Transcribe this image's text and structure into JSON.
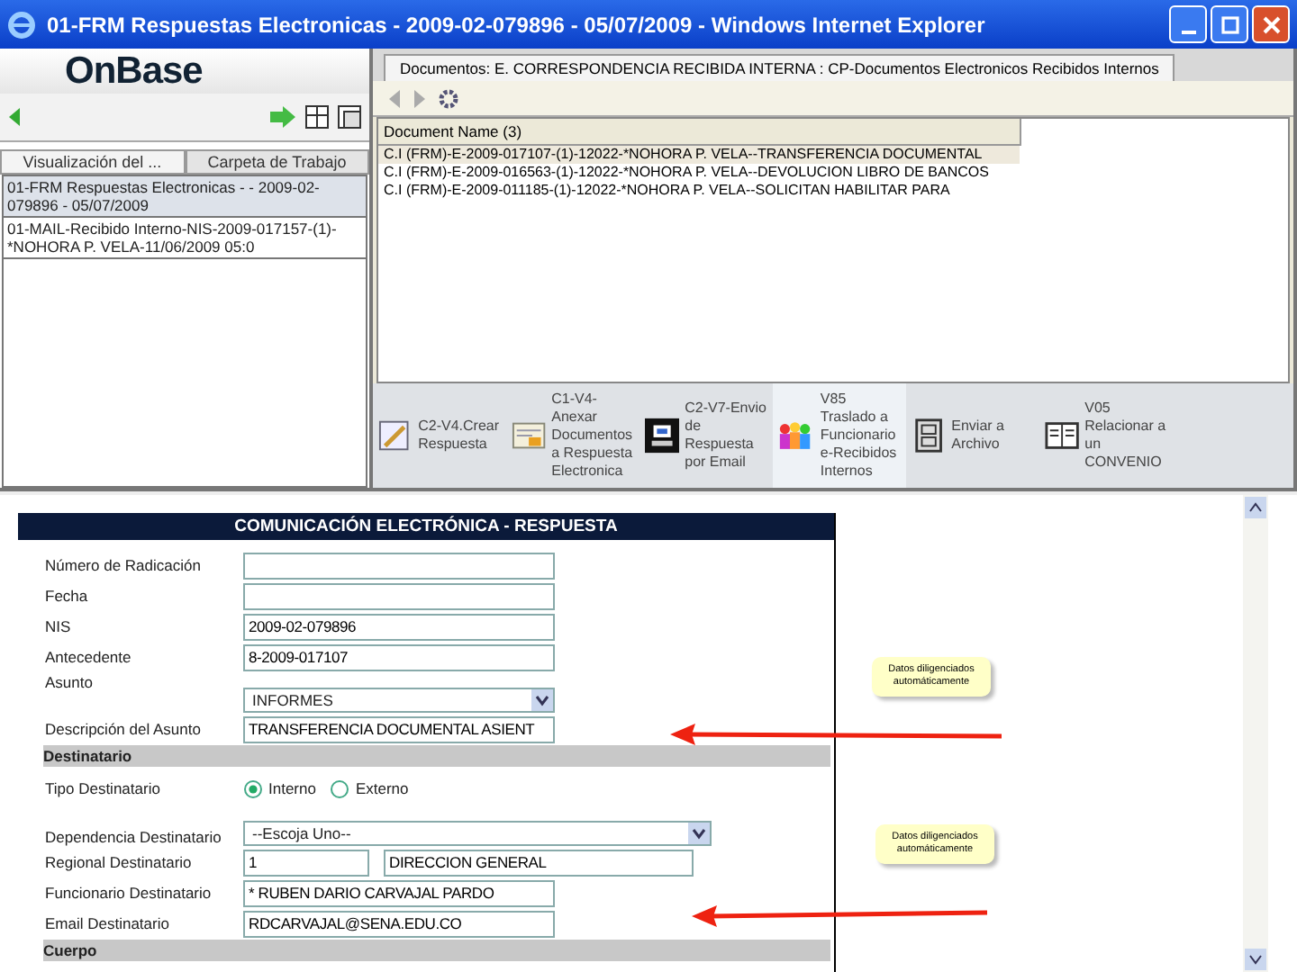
{
  "window": {
    "title": "01-FRM Respuestas Electronicas - 2009-02-079896 - 05/07/2009 - Windows Internet Explorer"
  },
  "logo": "OnBase",
  "left_tabs": [
    {
      "label": "Visualización del ...",
      "selected": true
    },
    {
      "label": "Carpeta de Trabajo",
      "selected": false
    }
  ],
  "left_items": [
    {
      "text": "01-FRM Respuestas Electronicas - - 2009-02-079896 - 05/07/2009",
      "selected": true
    },
    {
      "text": "01-MAIL-Recibido Interno-NIS-2009-017157-(1)-*NOHORA P. VELA-11/06/2009 05:0",
      "selected": false
    }
  ],
  "documents": {
    "tab": "Documentos: E. CORRESPONDENCIA RECIBIDA INTERNA : CP-Documentos Electronicos Recibidos Internos",
    "column": "Document Name (3)",
    "rows": [
      {
        "text": "C.I (FRM)-E-2009-017107-(1)-12022-*NOHORA P. VELA--TRANSFERENCIA DOCUMENTAL",
        "selected": true
      },
      {
        "text": "C.I (FRM)-E-2009-016563-(1)-12022-*NOHORA P. VELA--DEVOLUCION LIBRO DE BANCOS",
        "selected": false
      },
      {
        "text": "C.I (FRM)-E-2009-011185-(1)-12022-*NOHORA P. VELA--SOLICITAN HABILITAR PARA",
        "selected": false
      }
    ]
  },
  "tasks": [
    {
      "label": "C2-V4.Crear Respuesta",
      "selected": false
    },
    {
      "label": "C1-V4-Anexar Documentos a Respuesta Electronica",
      "selected": false
    },
    {
      "label": "C2-V7-Envio de Respuesta por Email",
      "selected": false
    },
    {
      "label": "V85 Traslado a Funcionario e-Recibidos Internos",
      "selected": true
    },
    {
      "label": "Enviar a Archivo",
      "selected": false
    },
    {
      "label": "V05 Relacionar a un CONVENIO",
      "selected": false
    }
  ],
  "form": {
    "title": "COMUNICACIÓN ELECTRÓNICA - RESPUESTA",
    "rows": [
      {
        "kind": "text",
        "label": "Número de Radicación"
      },
      {
        "kind": "text",
        "label": "Fecha"
      },
      {
        "kind": "text",
        "label": "NIS",
        "value": "2009-02-079896"
      },
      {
        "kind": "text",
        "label": "Antecedente",
        "value": "8-2009-017107"
      },
      {
        "kind": "select",
        "label": "Asunto",
        "value": "INFORMES"
      },
      {
        "kind": "text",
        "label": "Descripción del Asunto",
        "value": "TRANSFERENCIA DOCUMENTAL ASIENT"
      },
      {
        "kind": "section",
        "label": "Destinatario"
      },
      {
        "kind": "radio",
        "label": "Tipo Destinatario",
        "options": [
          {
            "label": "Interno",
            "selected": true
          },
          {
            "label": "Externo",
            "selected": false
          }
        ]
      },
      {
        "kind": "wide_select",
        "label": "Dependencia Destinatario",
        "value": "--Escoja Uno--"
      },
      {
        "kind": "pair",
        "label": "Regional Destinatario",
        "value": "1",
        "value_2": "DIRECCION GENERAL"
      },
      {
        "kind": "text",
        "label": "Funcionario Destinatario",
        "value": "* RUBEN DARIO CARVAJAL PARDO"
      },
      {
        "kind": "text",
        "label": "Email Destinatario",
        "value": "RDCARVAJAL@SENA.EDU.CO"
      },
      {
        "kind": "section",
        "label": "Cuerpo"
      }
    ]
  },
  "notes": [
    "Datos diligenciados automáticamente",
    "Datos diligenciados automáticamente"
  ]
}
